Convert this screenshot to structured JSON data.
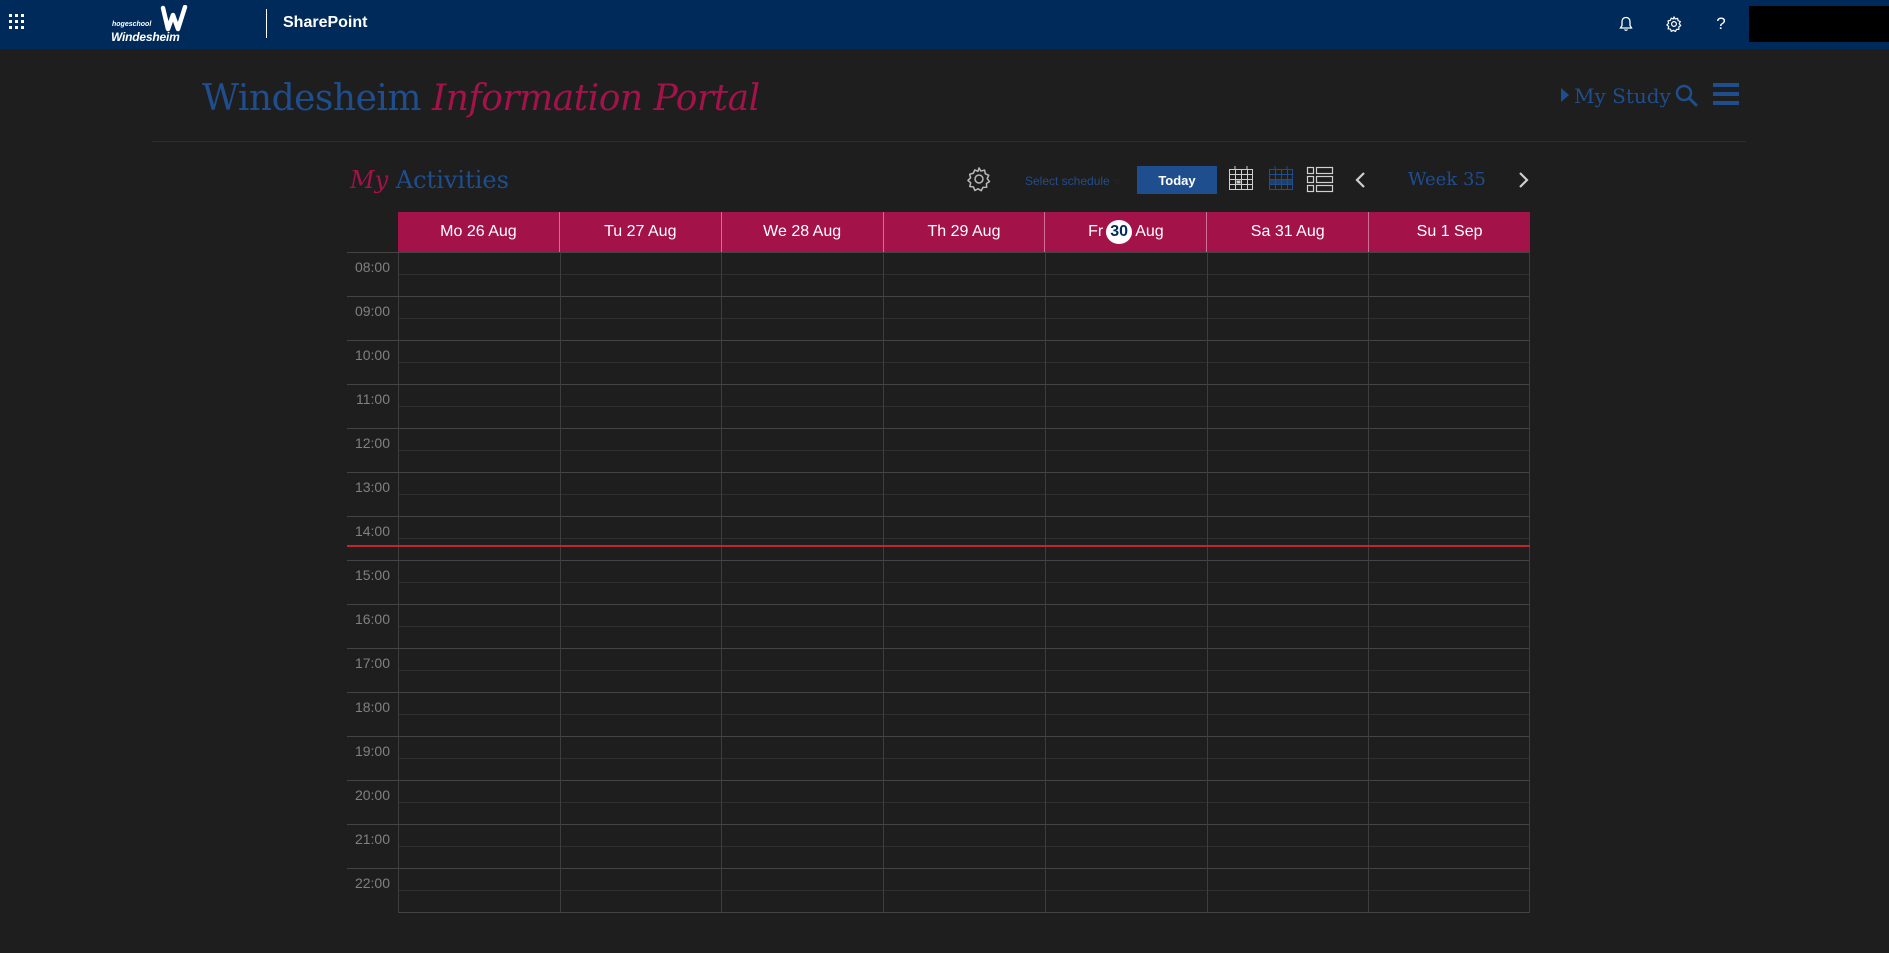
{
  "suite_bar": {
    "app_name": "SharePoint",
    "logo_small": "hogeschool",
    "logo_big": "Windesheim",
    "icons": [
      "waffle-icon",
      "bell-icon",
      "gear-icon",
      "help-icon"
    ],
    "background": "#002a59"
  },
  "portal": {
    "title_part1": "Windesheim",
    "title_part2": "Information Portal",
    "my_study": "My Study"
  },
  "activities": {
    "title_part1": "My",
    "title_part2": "Activities",
    "select_schedule": "Select schedule",
    "today_label": "Today",
    "week_label": "Week 35",
    "view_icons": [
      "week-grid-icon",
      "month-grid-icon",
      "list-view-icon"
    ]
  },
  "calendar": {
    "days": [
      {
        "prefix": "Mo 26 Aug",
        "num": "",
        "suffix": ""
      },
      {
        "prefix": "Tu 27 Aug",
        "num": "",
        "suffix": ""
      },
      {
        "prefix": "We 28 Aug",
        "num": "",
        "suffix": ""
      },
      {
        "prefix": "Th 29 Aug",
        "num": "",
        "suffix": ""
      },
      {
        "prefix": "Fr",
        "num": "30",
        "suffix": "Aug",
        "is_today": true
      },
      {
        "prefix": "Sa 31 Aug",
        "num": "",
        "suffix": ""
      },
      {
        "prefix": "Su 1 Sep",
        "num": "",
        "suffix": ""
      }
    ],
    "hours": [
      "08:00",
      "09:00",
      "10:00",
      "11:00",
      "12:00",
      "13:00",
      "14:00",
      "15:00",
      "16:00",
      "17:00",
      "18:00",
      "19:00",
      "20:00",
      "21:00",
      "22:00"
    ],
    "current_time_marker": "14:40",
    "colors": {
      "accent": "#a4124a",
      "primary": "#1f4e8f",
      "now_line": "#c0272d",
      "background": "#1e1e1e"
    }
  }
}
